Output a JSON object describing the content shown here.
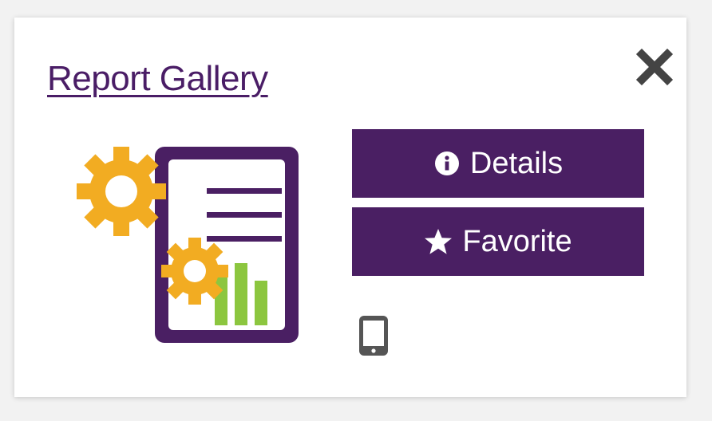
{
  "card": {
    "title": "Report Gallery",
    "close_icon": "close-icon",
    "illustration_icon": "report-gears-icon"
  },
  "actions": {
    "details_label": "Details",
    "details_icon": "info-circle-icon",
    "favorite_label": "Favorite",
    "favorite_icon": "star-icon"
  },
  "device_icon": "mobile-phone-icon",
  "colors": {
    "brand_purple": "#4a1f63",
    "gear_gold": "#f2ac22",
    "bar_green": "#8cc63f",
    "icon_gray": "#555555"
  }
}
